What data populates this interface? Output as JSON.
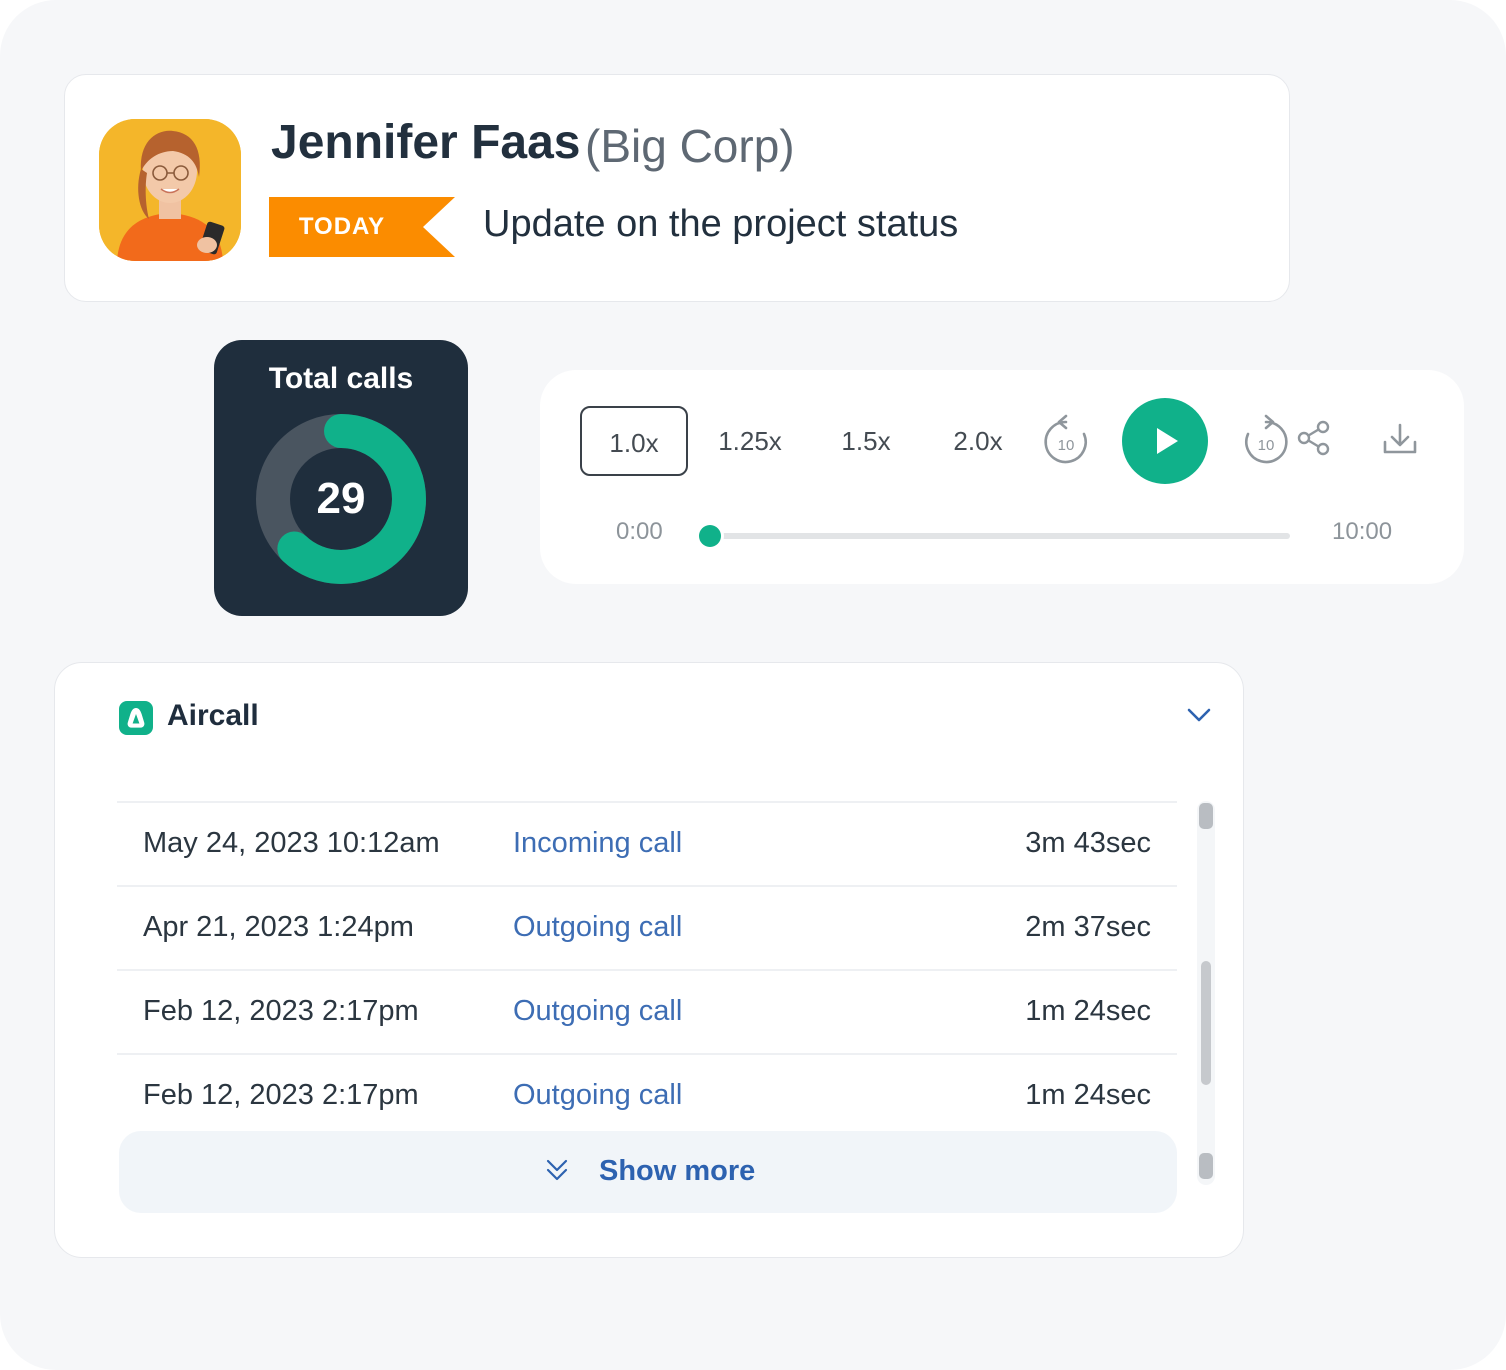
{
  "contact": {
    "name": "Jennifer Faas",
    "company": "(Big Corp)",
    "tag": "TODAY",
    "subject": "Update on the project status",
    "tag_color": "#fb8c00"
  },
  "total_calls": {
    "title": "Total calls",
    "value": "29",
    "progress_fraction": 0.62,
    "colors": {
      "fill": "#10b18a",
      "track": "#4a5560",
      "background": "#1f2e3d"
    }
  },
  "player": {
    "speeds": [
      "1.0x",
      "1.25x",
      "1.5x",
      "2.0x"
    ],
    "active_speed": "1.0x",
    "rewind_label": "10",
    "forward_label": "10",
    "current_time": "0:00",
    "total_time": "10:00",
    "progress_fraction": 0.0,
    "icons": [
      "rewind-10-icon",
      "play-icon",
      "forward-10-icon",
      "share-icon",
      "download-icon"
    ],
    "accent": "#10b18a"
  },
  "calls": {
    "title": "Aircall",
    "logo_icon": "aircall-logo-icon",
    "toggle_icon": "chevron-down-icon",
    "rows": [
      {
        "date": "May 24, 2023 10:12am",
        "type": "Incoming call",
        "duration": "3m 43sec"
      },
      {
        "date": "Apr 21, 2023 1:24pm",
        "type": "Outgoing call",
        "duration": "2m 37sec"
      },
      {
        "date": "Feb 12, 2023 2:17pm",
        "type": "Outgoing call",
        "duration": "1m 24sec"
      },
      {
        "date": "Feb 12, 2023 2:17pm",
        "type": "Outgoing call",
        "duration": "1m 24sec"
      }
    ],
    "show_more": "Show more",
    "link_color": "#3d6db4"
  }
}
